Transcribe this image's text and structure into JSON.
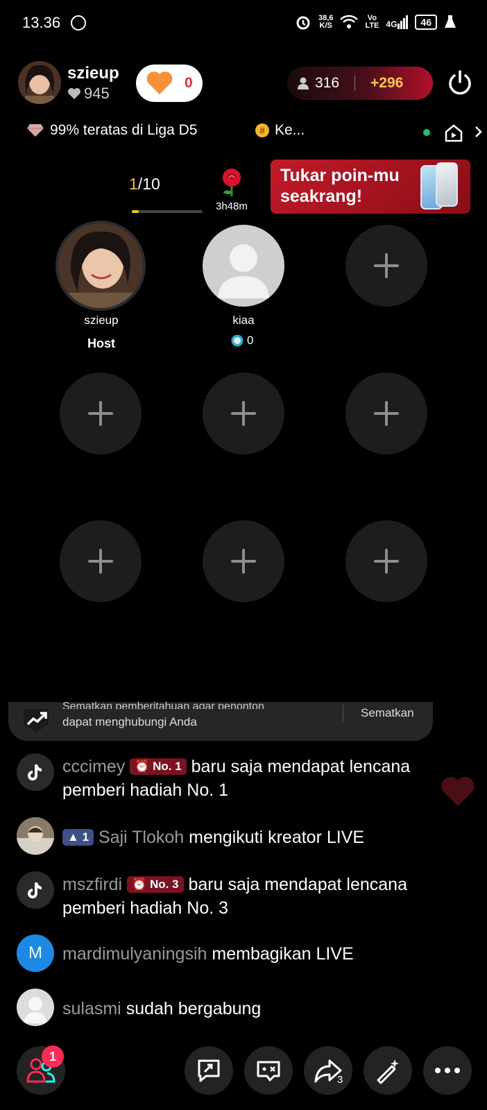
{
  "status_bar": {
    "time": "13.36",
    "net_speed": "38,6",
    "net_unit": "K/S",
    "volte": "Vo\nLTE",
    "signal": "4G",
    "battery": "46"
  },
  "host": {
    "name": "szieup",
    "likes": "945",
    "heart_count": "0",
    "viewers": "316",
    "viewers_new": "+296"
  },
  "league": {
    "rank_text": "99% teratas di Liga D5",
    "tag_text": "Ke..."
  },
  "room": {
    "progress_current": "1",
    "progress_total": "/10",
    "progress_fraction": 0.1,
    "rose_timer": "3h48m",
    "promo_text": "Tukar poin-mu seakrang!"
  },
  "seats": {
    "host_name": "szieup",
    "host_role": "Host",
    "guest_name": "kiaa",
    "guest_score": "0"
  },
  "pin_bar": {
    "text_line1": "Sematkan pemberitahuan agar penonton",
    "text_line2": "dapat menghubungi Anda",
    "button": "Sematkan"
  },
  "chat": [
    {
      "user": "cccimey",
      "badge": "No. 1",
      "text": "baru saja mendapat lencana pemberi hadiah No. 1"
    },
    {
      "user": "Saji Tlokoh",
      "badge": "1",
      "text": "mengikuti kreator LIVE"
    },
    {
      "user": "mszfirdi",
      "badge": "No. 3",
      "text": "baru saja mendapat lencana pemberi hadiah No. 3"
    },
    {
      "user": "mardimulyaningsih",
      "avatar_letter": "M",
      "text": "membagikan LIVE"
    },
    {
      "user": "sulasmi",
      "text": "sudah bergabung"
    }
  ],
  "bottom_bar": {
    "notif_count": "1",
    "share_count": "3"
  },
  "colors": {
    "accent_red": "#fe2c55",
    "progress_yellow": "#f3c233",
    "viewers_gold": "#f6c94b"
  }
}
